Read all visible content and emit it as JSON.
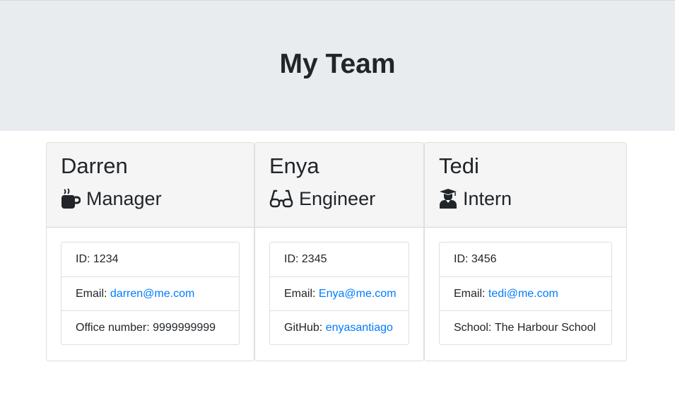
{
  "header": {
    "title": "My Team"
  },
  "team": [
    {
      "name": "Darren",
      "role": "Manager",
      "role_icon": "coffee-mug-icon",
      "id_label": "ID:",
      "id": "1234",
      "email_label": "Email:",
      "email": "darren@me.com",
      "extra_label": "Office number:",
      "extra": "9999999999"
    },
    {
      "name": "Enya",
      "role": "Engineer",
      "role_icon": "glasses-icon",
      "id_label": "ID:",
      "id": "2345",
      "email_label": "Email:",
      "email": "Enya@me.com",
      "extra_label": "GitHub:",
      "extra": "enyasantiago"
    },
    {
      "name": "Tedi",
      "role": "Intern",
      "role_icon": "graduate-icon",
      "id_label": "ID:",
      "id": "3456",
      "email_label": "Email:",
      "email": "tedi@me.com",
      "extra_label": "School:",
      "extra": "The Harbour School"
    }
  ],
  "colors": {
    "jumbotron": "#e9ecef",
    "link": "#007bff",
    "card_header": "#f5f5f5",
    "text": "#212529"
  }
}
